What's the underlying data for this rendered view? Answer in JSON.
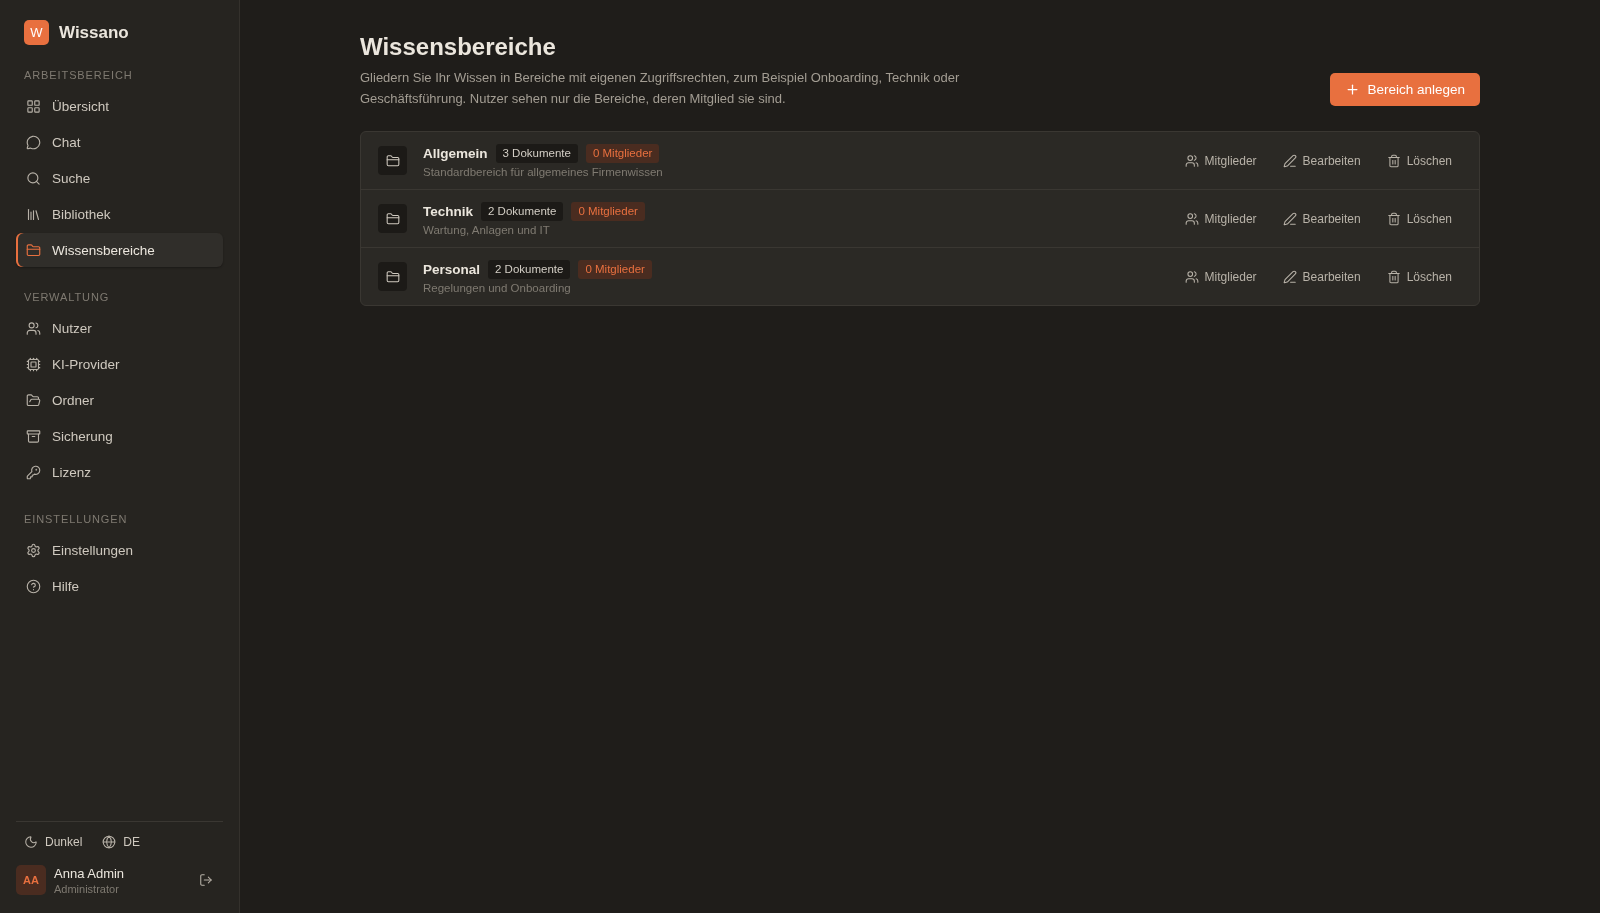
{
  "sidebar": {
    "brand": {
      "logo": "W",
      "name": "Wissano"
    },
    "sections": [
      {
        "title": "ARBEITSBEREICH",
        "items": [
          {
            "label": "Übersicht",
            "selected": false
          },
          {
            "label": "Chat",
            "selected": false
          },
          {
            "label": "Suche",
            "selected": false
          },
          {
            "label": "Bibliothek",
            "selected": false
          },
          {
            "label": "Wissensbereiche",
            "selected": true
          }
        ]
      },
      {
        "title": "VERWALTUNG",
        "items": [
          {
            "label": "Nutzer",
            "selected": false
          },
          {
            "label": "KI-Provider",
            "selected": false
          },
          {
            "label": "Ordner",
            "selected": false
          },
          {
            "label": "Sicherung",
            "selected": false
          },
          {
            "label": "Lizenz",
            "selected": false
          }
        ]
      },
      {
        "title": "EINSTELLUNGEN",
        "items": [
          {
            "label": "Einstellungen",
            "selected": false
          },
          {
            "label": "Hilfe",
            "selected": false
          }
        ]
      }
    ],
    "footer": {
      "theme": "Dunkel",
      "language": "DE",
      "user": {
        "initials": "AA",
        "name": "Anna Admin",
        "role": "Administrator"
      }
    }
  },
  "header": {
    "title": "Wissensbereiche",
    "description": "Gliedern Sie Ihr Wissen in Bereiche mit eigenen Zugriffsrechten, zum Beispiel Onboarding, Technik oder Geschäftsführung. Nutzer sehen nur die Bereiche, deren Mitglied sie sind.",
    "create_button": "Bereich anlegen"
  },
  "areas": [
    {
      "name": "Allgemein",
      "documents": "3 Dokumente",
      "members": "0 Mitglieder",
      "description": "Standardbereich für allgemeines Firmenwissen",
      "actions": [
        {
          "kind": "members",
          "label": "Mitglieder"
        },
        {
          "kind": "edit",
          "label": "Bearbeiten"
        },
        {
          "kind": "delete",
          "label": "Löschen"
        }
      ]
    },
    {
      "name": "Technik",
      "documents": "2 Dokumente",
      "members": "0 Mitglieder",
      "description": "Wartung, Anlagen und IT",
      "actions": [
        {
          "kind": "members",
          "label": "Mitglieder"
        },
        {
          "kind": "edit",
          "label": "Bearbeiten"
        },
        {
          "kind": "delete",
          "label": "Löschen"
        }
      ]
    },
    {
      "name": "Personal",
      "documents": "2 Dokumente",
      "members": "0 Mitglieder",
      "description": "Regelungen und Onboarding",
      "actions": [
        {
          "kind": "members",
          "label": "Mitglieder"
        },
        {
          "kind": "edit",
          "label": "Bearbeiten"
        },
        {
          "kind": "delete",
          "label": "Löschen"
        }
      ]
    }
  ]
}
